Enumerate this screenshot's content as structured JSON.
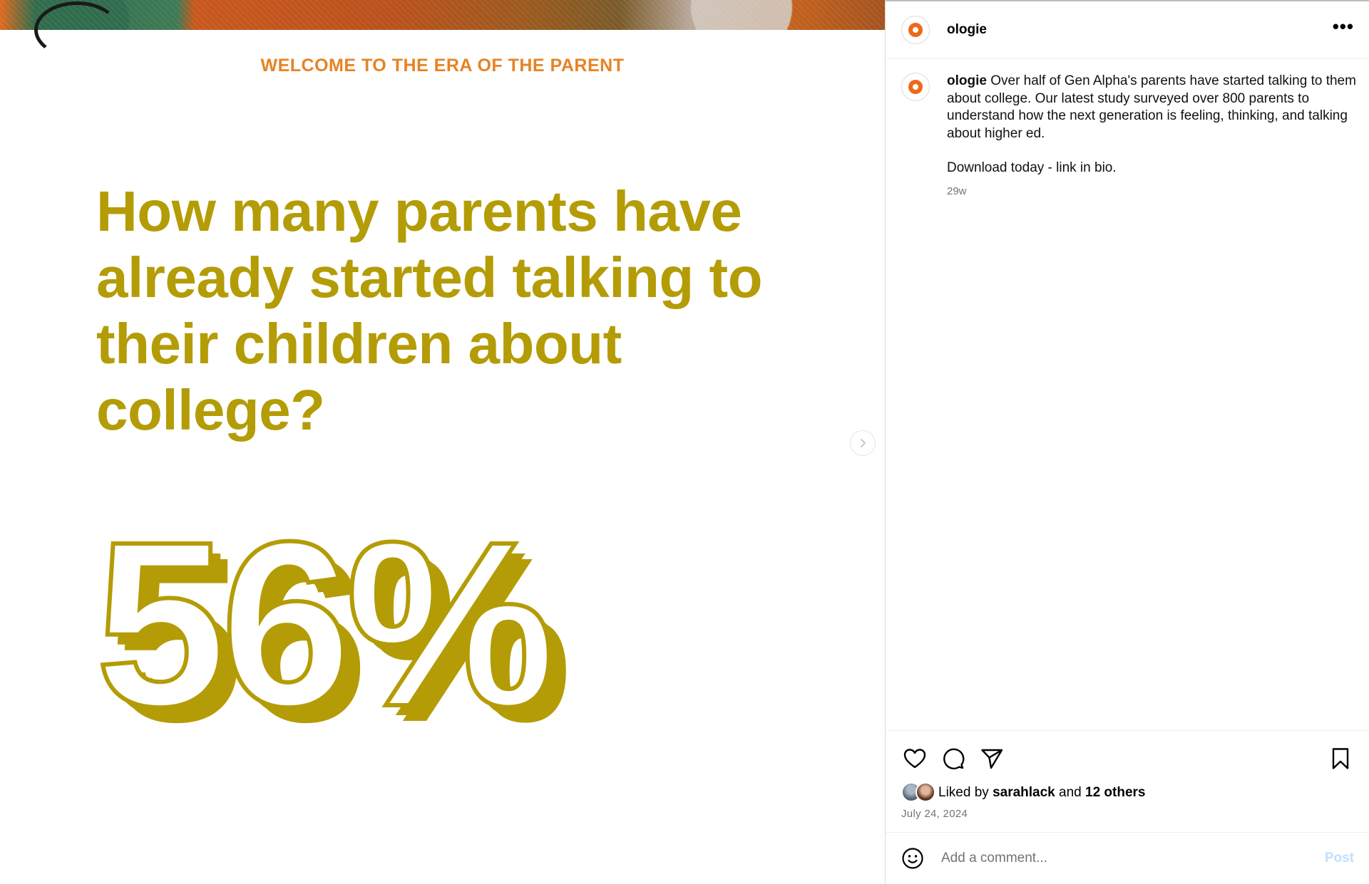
{
  "colors": {
    "accent_orange": "#e68324",
    "headline_olive": "#b49c06",
    "brand_orange": "#ee6a1b",
    "muted_text": "#737373",
    "post_disabled": "#c0dffd"
  },
  "media": {
    "kicker": "WELCOME TO THE ERA OF THE PARENT",
    "headline": "How many parents have already started talking to their children about college?",
    "stat": "56%",
    "next_icon": "chevron-right-icon"
  },
  "post": {
    "username": "ologie",
    "caption_user": "ologie",
    "caption_text": "Over half of Gen Alpha's parents have started talking to them about college. Our latest study surveyed over 800 parents to understand how the next generation is feeling, thinking, and talking about higher ed.",
    "caption_cta": "Download today - link in bio.",
    "age": "29w",
    "likes_prefix": "Liked by",
    "liked_by_user": "sarahlack",
    "likes_and": "and",
    "likes_others": "12 others",
    "date": "July 24, 2024",
    "comment_placeholder": "Add a comment...",
    "post_label": "Post"
  },
  "icons": [
    "more-options-icon",
    "heart-icon",
    "comment-icon",
    "share-icon",
    "bookmark-icon",
    "emoji-icon"
  ]
}
